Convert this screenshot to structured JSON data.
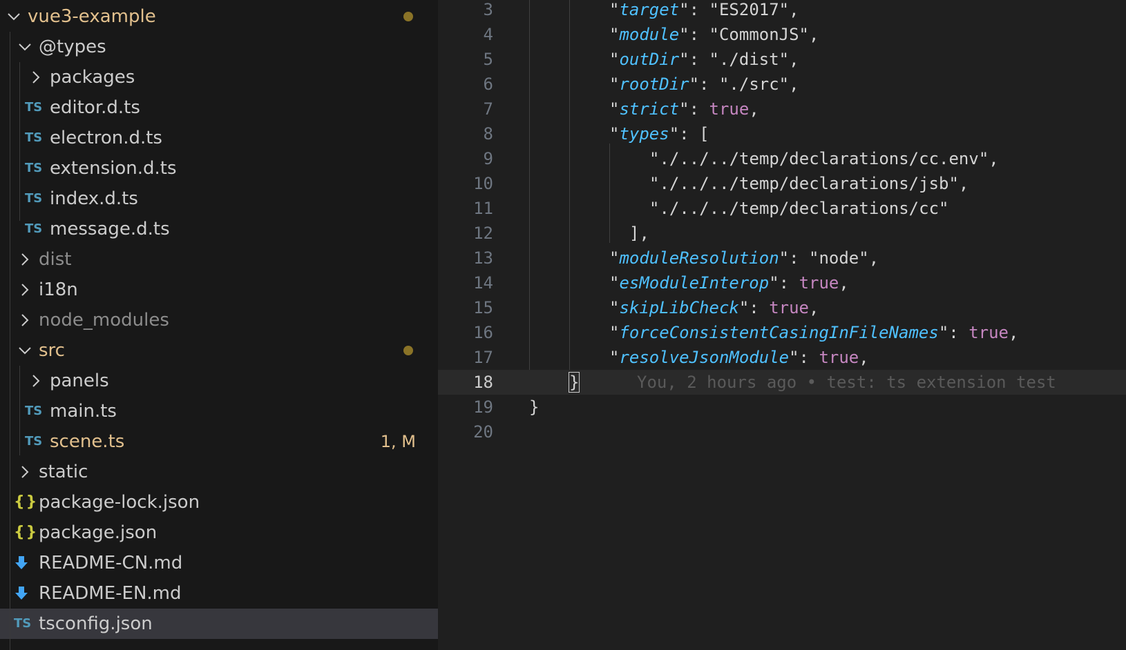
{
  "explorer": {
    "items": [
      {
        "label": "vue3-example",
        "kind": "root",
        "icon": "chevron-down-icon",
        "dot": true
      },
      {
        "label": "@types",
        "kind": "folder-open",
        "icon": "chevron-down-icon"
      },
      {
        "label": "packages",
        "kind": "folder",
        "icon": "chevron-right-icon"
      },
      {
        "label": "editor.d.ts",
        "kind": "ts",
        "icon": "TS"
      },
      {
        "label": "electron.d.ts",
        "kind": "ts",
        "icon": "TS"
      },
      {
        "label": "extension.d.ts",
        "kind": "ts",
        "icon": "TS"
      },
      {
        "label": "index.d.ts",
        "kind": "ts",
        "icon": "TS"
      },
      {
        "label": "message.d.ts",
        "kind": "ts",
        "icon": "TS"
      },
      {
        "label": "dist",
        "kind": "folder-muted",
        "icon": "chevron-right-icon"
      },
      {
        "label": "i18n",
        "kind": "folder",
        "icon": "chevron-right-icon"
      },
      {
        "label": "node_modules",
        "kind": "folder-muted",
        "icon": "chevron-right-icon"
      },
      {
        "label": "src",
        "kind": "folder-open-modified",
        "icon": "chevron-down-icon",
        "dot": true
      },
      {
        "label": "panels",
        "kind": "folder",
        "icon": "chevron-right-icon"
      },
      {
        "label": "main.ts",
        "kind": "ts",
        "icon": "TS"
      },
      {
        "label": "scene.ts",
        "kind": "ts-modified",
        "icon": "TS",
        "badge": "1, M"
      },
      {
        "label": "static",
        "kind": "folder",
        "icon": "chevron-right-icon"
      },
      {
        "label": "package-lock.json",
        "kind": "json",
        "icon": "{}"
      },
      {
        "label": "package.json",
        "kind": "json",
        "icon": "{}"
      },
      {
        "label": "README-CN.md",
        "kind": "md",
        "icon": "markdown-icon"
      },
      {
        "label": "README-EN.md",
        "kind": "md",
        "icon": "markdown-icon"
      },
      {
        "label": "tsconfig.json",
        "kind": "tsconfig",
        "icon": "TS",
        "selected": true
      }
    ]
  },
  "editor": {
    "lines": [
      {
        "n": "3",
        "indent": 2,
        "key": "target",
        "val": "\"ES2017\"",
        "valtype": "str",
        "trail": ","
      },
      {
        "n": "4",
        "indent": 2,
        "key": "module",
        "val": "\"CommonJS\"",
        "valtype": "str",
        "trail": ","
      },
      {
        "n": "5",
        "indent": 2,
        "key": "outDir",
        "val": "\"./dist\"",
        "valtype": "str",
        "trail": ","
      },
      {
        "n": "6",
        "indent": 2,
        "key": "rootDir",
        "val": "\"./src\"",
        "valtype": "str",
        "trail": ","
      },
      {
        "n": "7",
        "indent": 2,
        "key": "strict",
        "val": "true",
        "valtype": "kw",
        "trail": ","
      },
      {
        "n": "8",
        "indent": 2,
        "key": "types",
        "val": "[",
        "valtype": "str",
        "trail": ""
      },
      {
        "n": "9",
        "indent": 3,
        "raw": "\"./../../temp/declarations/cc.env\","
      },
      {
        "n": "10",
        "indent": 3,
        "raw": "\"./../../temp/declarations/jsb\","
      },
      {
        "n": "11",
        "indent": 3,
        "raw": "\"./../../temp/declarations/cc\""
      },
      {
        "n": "12",
        "indent": 2.5,
        "raw": "],"
      },
      {
        "n": "13",
        "indent": 2,
        "key": "moduleResolution",
        "val": "\"node\"",
        "valtype": "str",
        "trail": ","
      },
      {
        "n": "14",
        "indent": 2,
        "key": "esModuleInterop",
        "val": "true",
        "valtype": "kw",
        "trail": ","
      },
      {
        "n": "15",
        "indent": 2,
        "key": "skipLibCheck",
        "val": "true",
        "valtype": "kw",
        "trail": ","
      },
      {
        "n": "16",
        "indent": 2,
        "key": "forceConsistentCasingInFileNames",
        "val": "true",
        "valtype": "kw",
        "trail": ","
      },
      {
        "n": "17",
        "indent": 2,
        "key": "resolveJsonModule",
        "val": "true",
        "valtype": "kw",
        "trail": ","
      },
      {
        "n": "18",
        "indent": 1,
        "raw": "}",
        "current": true,
        "blame": "You, 2 hours ago • test: ts extension test"
      },
      {
        "n": "19",
        "indent": 0,
        "raw": "}"
      },
      {
        "n": "20",
        "indent": 0,
        "raw": ""
      }
    ]
  }
}
